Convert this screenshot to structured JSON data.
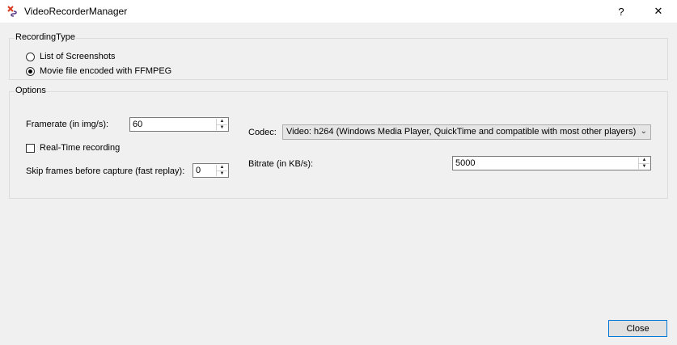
{
  "window": {
    "title": "VideoRecorderManager",
    "help_label": "?",
    "close_label": "✕"
  },
  "recording_type": {
    "title": "RecordingType",
    "options": [
      {
        "label": "List of Screenshots",
        "checked": false
      },
      {
        "label": "Movie file encoded with FFMPEG",
        "checked": true
      }
    ]
  },
  "options": {
    "title": "Options",
    "framerate_label": "Framerate (in img/s):",
    "framerate_value": "60",
    "realtime_label": "Real-Time recording",
    "realtime_checked": false,
    "skip_label": "Skip frames before capture (fast replay):",
    "skip_value": "0",
    "codec_label": "Codec:",
    "codec_value": "Video: h264  (Windows Media Player, QuickTime and compatible with most other players)",
    "bitrate_label": "Bitrate (in KB/s):",
    "bitrate_value": "5000"
  },
  "footer": {
    "close_button": "Close"
  }
}
